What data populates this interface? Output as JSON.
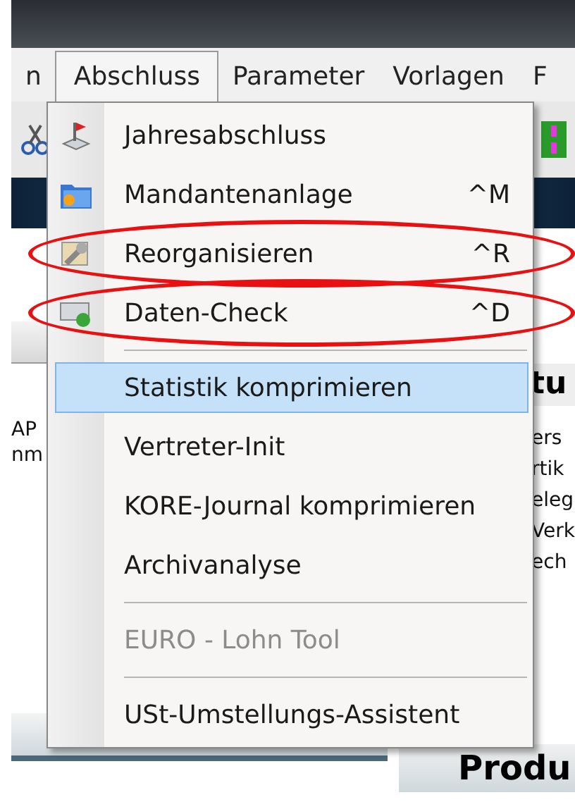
{
  "menu_bar": [
    {
      "label": "n",
      "selected": false
    },
    {
      "label": "Abschluss",
      "selected": true
    },
    {
      "label": "Parameter",
      "selected": false
    },
    {
      "label": "Vorlagen",
      "selected": false
    },
    {
      "label": "F",
      "selected": false
    }
  ],
  "background": {
    "left_fragments": [
      "AP",
      "nm"
    ],
    "right_heading": "tu",
    "right_fragments": [
      "ers",
      "rtik",
      "eleg",
      "Verk",
      "ech"
    ],
    "bottom_heading": "Produ"
  },
  "menu": [
    {
      "kind": "item",
      "label": "Jahresabschluss",
      "selected": false,
      "disabled": false,
      "circled": false
    },
    {
      "kind": "item",
      "label": "Mandantenanlage",
      "shortcut": "^M",
      "selected": false,
      "disabled": false,
      "circled": false
    },
    {
      "kind": "item",
      "label": "Reorganisieren",
      "shortcut": "^R",
      "selected": false,
      "disabled": false,
      "circled": true
    },
    {
      "kind": "item",
      "label": "Daten-Check",
      "shortcut": "^D",
      "selected": false,
      "disabled": false,
      "circled": true
    },
    {
      "kind": "separator"
    },
    {
      "kind": "item",
      "label": "Statistik komprimieren",
      "selected": true,
      "disabled": false,
      "circled": false
    },
    {
      "kind": "item",
      "label": "Vertreter-Init",
      "selected": false,
      "disabled": false,
      "circled": false
    },
    {
      "kind": "item",
      "label": "KORE-Journal komprimieren",
      "selected": false,
      "disabled": false,
      "circled": false
    },
    {
      "kind": "item",
      "label": "Archivanalyse",
      "selected": false,
      "disabled": false,
      "circled": false
    },
    {
      "kind": "separator"
    },
    {
      "kind": "item",
      "label": "EURO - Lohn Tool",
      "selected": false,
      "disabled": true,
      "circled": false
    },
    {
      "kind": "separator"
    },
    {
      "kind": "item",
      "label": "USt-Umstellungs-Assistent",
      "selected": false,
      "disabled": false,
      "circled": false
    }
  ]
}
